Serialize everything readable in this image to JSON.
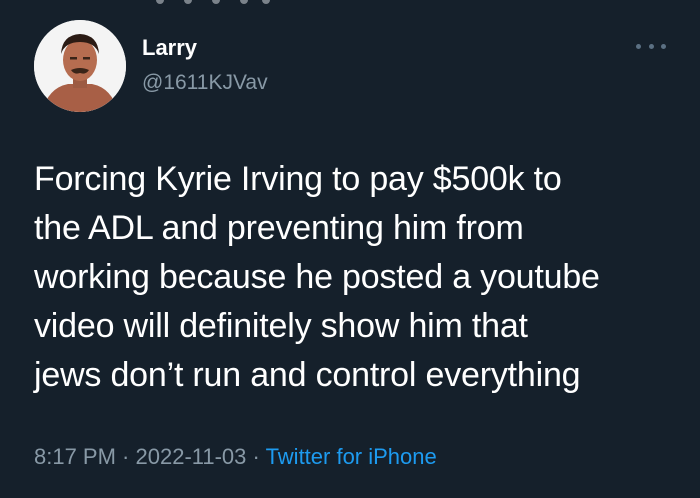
{
  "author": {
    "display_name": "Larry",
    "handle": "@1611KJVav",
    "avatar_icon": "user-avatar"
  },
  "more_icon": "more-dots-icon",
  "tweet": {
    "lines": [
      "Forcing Kyrie Irving to pay $500k to",
      "the ADL and preventing him from",
      "working because he posted a youtube",
      "video will definitely show him that",
      "jews don’t run and control everything"
    ]
  },
  "meta": {
    "time": "8:17 PM",
    "sep1": " · ",
    "date": "2022-11-03",
    "sep2": " · ",
    "source": "Twitter for iPhone"
  },
  "colors": {
    "background": "#15202b",
    "text_primary": "#ffffff",
    "text_secondary": "#8899a6",
    "link": "#1d9bf0"
  }
}
